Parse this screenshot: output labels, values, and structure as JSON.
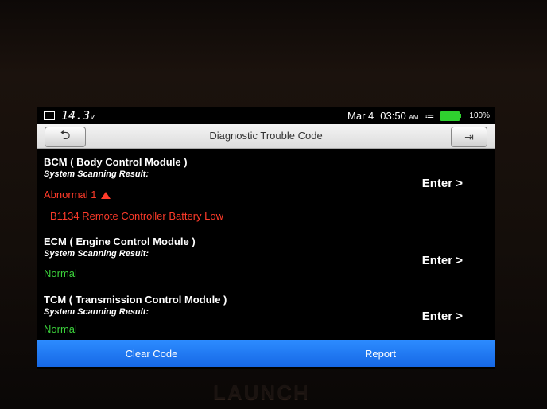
{
  "status_bar": {
    "voltage": "14.3",
    "voltage_unit": "v",
    "date": "Mar 4",
    "time": "03:50",
    "ampm": "AM",
    "battery_percent": "100%"
  },
  "header": {
    "title": "Diagnostic Trouble Code",
    "back_icon": "back-arrow-icon",
    "exit_icon": "exit-icon"
  },
  "modules": [
    {
      "name": "BCM ( Body Control Module )",
      "sub": "System Scanning Result:",
      "status": "Abnormal 1",
      "dtc": "B1134 Remote Controller Battery Low",
      "enter": "Enter >"
    },
    {
      "name": "ECM ( Engine Control Module )",
      "sub": "System Scanning Result:",
      "status": "Normal",
      "enter": "Enter >"
    },
    {
      "name": "TCM ( Transmission Control Module )",
      "sub": "System Scanning Result:",
      "status": "Normal",
      "enter": "Enter >"
    }
  ],
  "buttons": {
    "clear": "Clear Code",
    "report": "Report"
  },
  "brand": "LAUNCH",
  "colors": {
    "abnormal": "#ff3b2a",
    "normal": "#3bd13b",
    "button": "#1f7bf2"
  }
}
